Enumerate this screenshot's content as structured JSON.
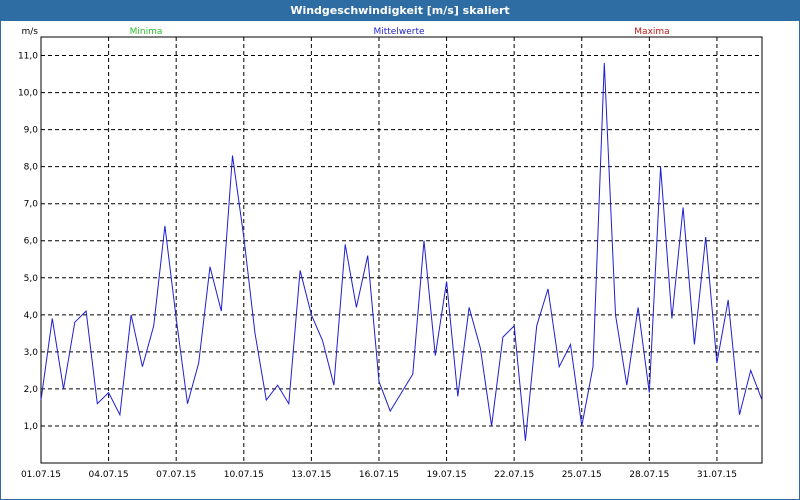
{
  "window": {
    "title": "Windgeschwindigkeit [m/s] skaliert"
  },
  "legend": {
    "min_label": "Minima",
    "min_color": "#2bbf2b",
    "mean_label": "Mittelwerte",
    "mean_color": "#1f1fd0",
    "max_label": "Maxima",
    "max_color": "#c01818"
  },
  "chart_data": {
    "type": "line",
    "title": "Windgeschwindigkeit [m/s] skaliert",
    "ylabel": "m/s",
    "xlabel": "",
    "ylim": [
      0,
      11.5
    ],
    "xlim": [
      "01.07.15",
      "02.08.15"
    ],
    "yticks": [
      "1,0",
      "2,0",
      "3,0",
      "4,0",
      "5,0",
      "6,0",
      "7,0",
      "8,0",
      "9,0",
      "10,0",
      "11,0"
    ],
    "xticks": [
      "01.07.15",
      "04.07.15",
      "07.07.15",
      "10.07.15",
      "13.07.15",
      "16.07.15",
      "19.07.15",
      "22.07.15",
      "25.07.15",
      "28.07.15",
      "31.07.15"
    ],
    "grid": true,
    "series_color": "#1f1fd0",
    "series": [
      {
        "name": "Mittelwerte",
        "x": [
          "2015-07-01",
          "2015-07-01 12:00",
          "2015-07-02",
          "2015-07-02 12:00",
          "2015-07-03",
          "2015-07-03 12:00",
          "2015-07-04",
          "2015-07-04 12:00",
          "2015-07-05",
          "2015-07-05 12:00",
          "2015-07-06",
          "2015-07-06 12:00",
          "2015-07-07",
          "2015-07-07 12:00",
          "2015-07-08",
          "2015-07-08 12:00",
          "2015-07-09",
          "2015-07-09 12:00",
          "2015-07-10",
          "2015-07-10 12:00",
          "2015-07-11",
          "2015-07-11 12:00",
          "2015-07-12",
          "2015-07-12 12:00",
          "2015-07-13",
          "2015-07-13 12:00",
          "2015-07-14",
          "2015-07-14 12:00",
          "2015-07-15",
          "2015-07-15 12:00",
          "2015-07-16",
          "2015-07-16 12:00",
          "2015-07-17",
          "2015-07-17 12:00",
          "2015-07-18",
          "2015-07-18 12:00",
          "2015-07-19",
          "2015-07-19 12:00",
          "2015-07-20",
          "2015-07-20 12:00",
          "2015-07-21",
          "2015-07-21 12:00",
          "2015-07-22",
          "2015-07-22 12:00",
          "2015-07-23",
          "2015-07-23 12:00",
          "2015-07-24",
          "2015-07-24 12:00",
          "2015-07-25",
          "2015-07-25 12:00",
          "2015-07-26",
          "2015-07-26 12:00",
          "2015-07-27",
          "2015-07-27 12:00",
          "2015-07-28",
          "2015-07-28 12:00",
          "2015-07-29",
          "2015-07-29 12:00",
          "2015-07-30",
          "2015-07-30 12:00",
          "2015-07-31",
          "2015-07-31 12:00",
          "2015-08-01",
          "2015-08-01 12:00",
          "2015-08-02"
        ],
        "values": [
          1.7,
          3.9,
          2.0,
          3.8,
          4.1,
          1.6,
          1.9,
          1.3,
          4.0,
          2.6,
          3.7,
          6.4,
          3.9,
          1.6,
          2.7,
          5.3,
          4.1,
          8.3,
          6.1,
          3.5,
          1.7,
          2.1,
          1.6,
          5.2,
          4.0,
          3.3,
          2.1,
          5.9,
          4.2,
          5.6,
          2.2,
          1.4,
          1.9,
          2.4,
          6.0,
          2.9,
          4.9,
          1.8,
          4.2,
          3.1,
          1.0,
          3.4,
          3.7,
          0.6,
          3.7,
          4.7,
          2.6,
          3.2,
          1.0,
          2.6,
          10.8,
          4.0,
          2.1,
          4.2,
          1.9,
          8.0,
          3.9,
          6.9,
          3.2,
          6.1,
          2.7,
          4.4,
          1.3,
          2.5,
          1.7
        ]
      }
    ]
  }
}
